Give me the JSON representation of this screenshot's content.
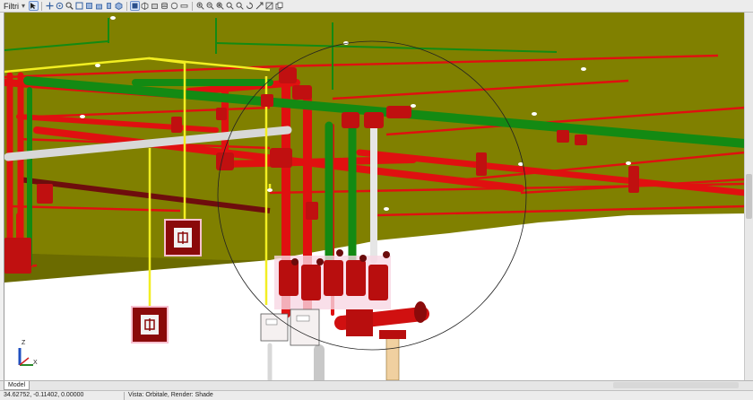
{
  "toolbar": {
    "filter_label": "Filtri",
    "filter_dropdown": "▾",
    "icons": [
      "select-icon",
      "pan-icon",
      "orbit-icon",
      "zoom-icon",
      "zoom-window-icon",
      "view-top-icon",
      "view-front-icon",
      "view-side-icon",
      "view-iso-icon",
      "shade-icon",
      "wireframe-icon",
      "box-icon",
      "cylinder-icon",
      "sphere-icon",
      "measure-icon",
      "zoom-in-icon",
      "zoom-out-icon",
      "zoom-fit-icon",
      "zoom-prev-icon",
      "zoom-next-icon",
      "rotate-icon",
      "link-icon",
      "section-icon",
      "copy-icon"
    ]
  },
  "tabs": {
    "model": "Model"
  },
  "status": {
    "coordinates": "34.62752, -0.11402, 0.00000",
    "view_info": "Vista: Orbitale, Render: Shade"
  },
  "axis_gizmo": {
    "z": "Z",
    "x": "X"
  },
  "colors": {
    "ceiling": "#808000",
    "red_pipe": "#e01010",
    "green_pipe": "#138a13",
    "yellow_hanger": "#f2ee22",
    "gray_pipe": "#d8d8d8"
  }
}
